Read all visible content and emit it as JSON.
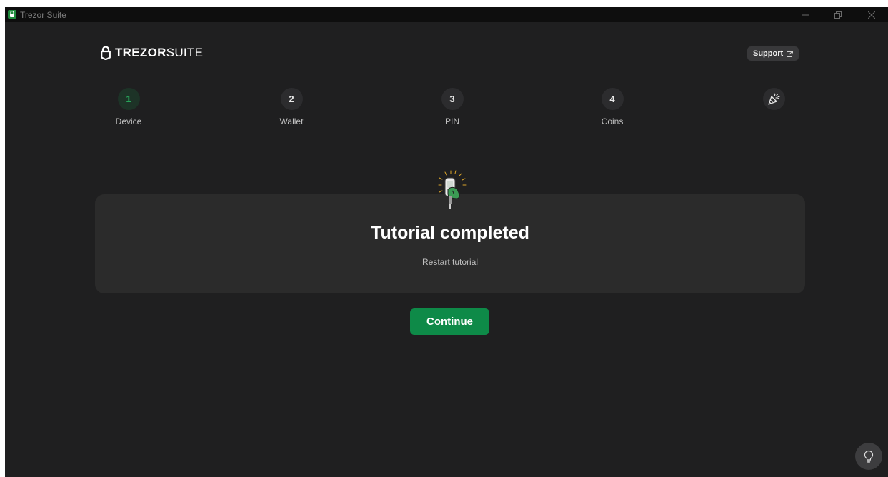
{
  "titlebar": {
    "title": "Trezor Suite"
  },
  "header": {
    "logo_brand": "TREZOR",
    "logo_suite": "SUITE",
    "support_label": "Support"
  },
  "steps": [
    {
      "number": "1",
      "label": "Device",
      "state": "active"
    },
    {
      "number": "2",
      "label": "Wallet",
      "state": "pending"
    },
    {
      "number": "3",
      "label": "PIN",
      "state": "pending"
    },
    {
      "number": "4",
      "label": "Coins",
      "state": "pending"
    }
  ],
  "final_step_icon": "party-popper-icon",
  "main": {
    "heading": "Tutorial completed",
    "restart_link": "Restart tutorial",
    "continue_label": "Continue"
  },
  "floating": {
    "tips_icon": "lightbulb-icon"
  },
  "colors": {
    "accent": "#0e8a48",
    "background": "#1f1f20",
    "card": "#2b2b2b",
    "active_step": "#27a55a"
  }
}
